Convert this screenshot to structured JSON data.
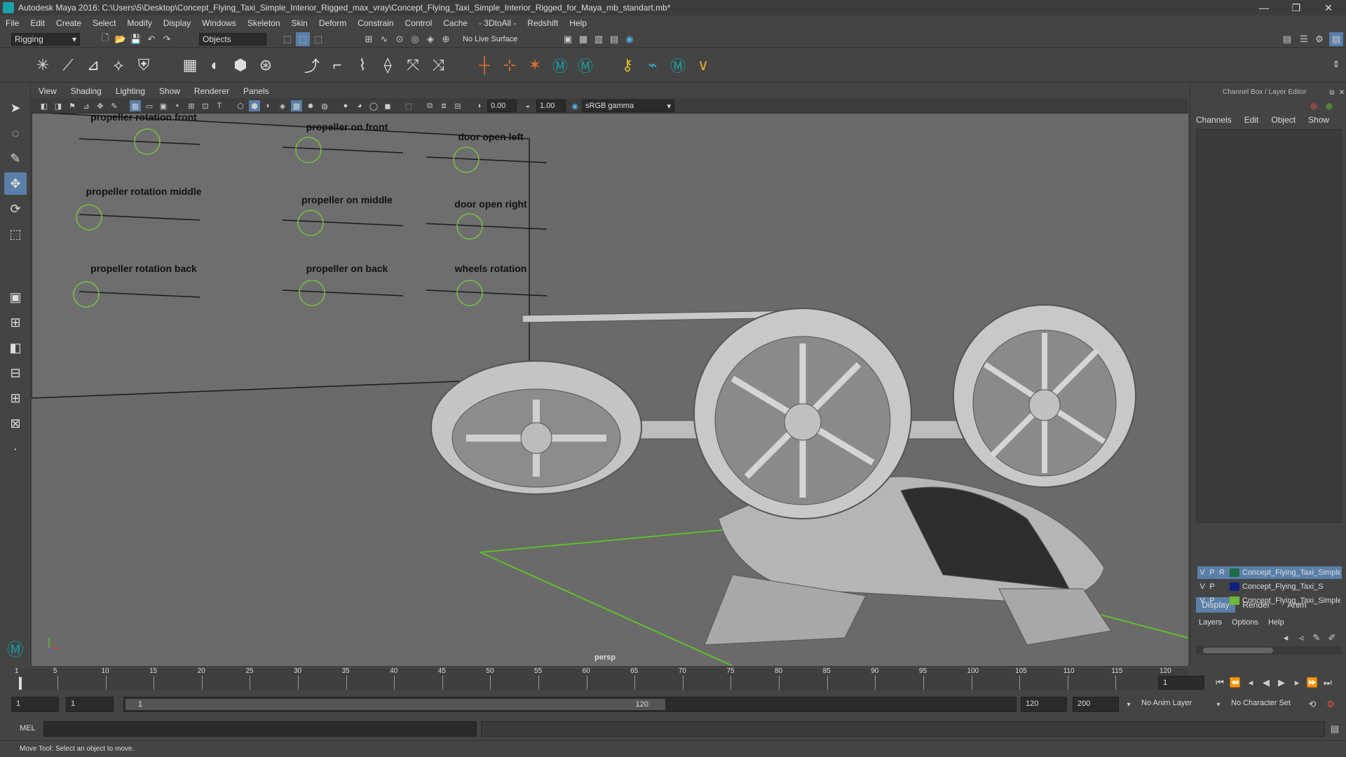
{
  "window": {
    "title": "Autodesk Maya 2016: C:\\Users\\5\\Desktop\\Concept_Flying_Taxi_Simple_Interior_Rigged_max_vray\\Concept_Flying_Taxi_Simple_Interior_Rigged_for_Maya_mb_standart.mb*",
    "minimize": "—",
    "restore": "❐",
    "close": "✕"
  },
  "menubar": [
    "File",
    "Edit",
    "Create",
    "Select",
    "Modify",
    "Display",
    "Windows",
    "Skeleton",
    "Skin",
    "Deform",
    "Constrain",
    "Control",
    "Cache",
    "- 3DtoAll -",
    "Redshift",
    "Help"
  ],
  "statusline": {
    "mode": "Rigging",
    "selection_mode": "Objects",
    "live_surface": "No Live Surface"
  },
  "panel": {
    "menus": [
      "View",
      "Shading",
      "Lighting",
      "Show",
      "Renderer",
      "Panels"
    ],
    "near_clip": "0.00",
    "gamma_value": "1.00",
    "color_space": "sRGB gamma",
    "camera_label": "persp"
  },
  "rig_controls": {
    "labels": [
      "propeller rotation front",
      "propeller on front",
      "door open left",
      "propeller rotation middle",
      "propeller on middle",
      "door open right",
      "propeller rotation back",
      "propeller on back",
      "wheels rotation"
    ]
  },
  "channel_box": {
    "title": "Channel Box / Layer Editor",
    "menus": [
      "Channels",
      "Edit",
      "Object",
      "Show"
    ],
    "tabs": [
      "Display",
      "Render",
      "Anim"
    ],
    "layer_menus": [
      "Layers",
      "Options",
      "Help"
    ],
    "layers": [
      {
        "v": "V",
        "p": "P",
        "r": "R",
        "name": "Concept_Flying_Taxi_Simple_",
        "color": "#1e6b4a",
        "selected": true
      },
      {
        "v": "V",
        "p": "P",
        "r": "",
        "name": "Concept_Flying_Taxi_S",
        "color": "#102080",
        "selected": false
      },
      {
        "v": "V",
        "p": "P",
        "r": "",
        "name": "Concept_Flying_Taxi_Simple_",
        "color": "#6fb83a",
        "selected": false
      }
    ]
  },
  "timeline": {
    "ticks": [
      "1",
      "5",
      "10",
      "15",
      "20",
      "25",
      "30",
      "35",
      "40",
      "45",
      "50",
      "55",
      "60",
      "65",
      "70",
      "75",
      "80",
      "85",
      "90",
      "95",
      "100",
      "105",
      "110",
      "115",
      "120"
    ],
    "current_frame": "1"
  },
  "range": {
    "start": "1",
    "playback_start": "1",
    "slider_start": "1",
    "slider_end": "120",
    "playback_end": "120",
    "end": "200",
    "anim_layer": "No Anim Layer",
    "character_set": "No Character Set"
  },
  "cmdline": {
    "lang": "MEL"
  },
  "helpline": {
    "text": "Move Tool: Select an object to move."
  },
  "colors": {
    "accent": "#5a9fd4",
    "control_green": "#7ac142",
    "grid_green": "#5fbf2a"
  }
}
